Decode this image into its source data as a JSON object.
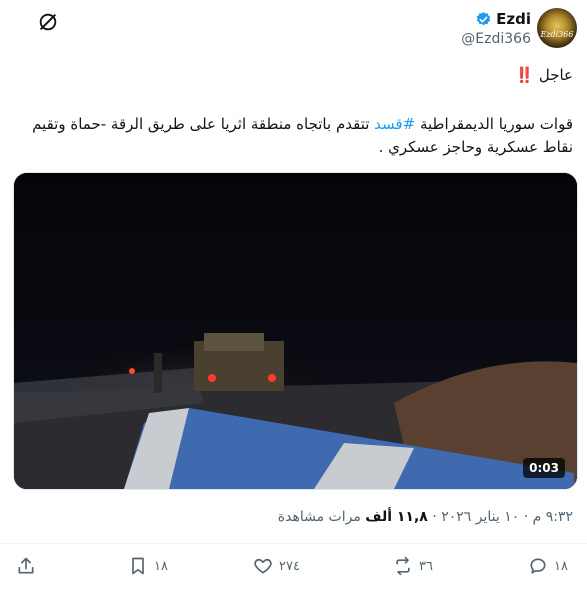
{
  "author": {
    "display_name": "Ezdi",
    "handle": "@Ezdi366",
    "avatar_text": "Ezdi366"
  },
  "post": {
    "urgent_label": "عاجل",
    "urgent_marks": "‼️",
    "text_before_hashtag": "قوات سوريا الديمقراطية ",
    "hashtag": "#قسد",
    "text_after_hashtag": " تتقدم باتجاه منطقة اثريا على طريق الرقة -حماة وتقيم نقاط عسكرية وحاجز عسكري ."
  },
  "video": {
    "duration": "0:03"
  },
  "meta": {
    "time_date": "٩:٣٢ م · ١٠ يناير ٢٠٢٦ · ",
    "views_count": "١١,٨ ألف",
    "views_label": " مرات مشاهدة"
  },
  "actions": {
    "replies": "١٨",
    "reposts": "٣٦",
    "likes": "٢٧٤",
    "bookmarks": "١٨"
  },
  "icons": {
    "grok": "grok-icon",
    "verified": "verified-badge-icon",
    "share": "share-icon",
    "bookmark": "bookmark-icon",
    "like": "heart-icon",
    "repost": "repost-icon",
    "reply": "reply-icon"
  },
  "colors": {
    "accent": "#1d9bf0",
    "muted": "#536471",
    "urgent": "#e0102b"
  }
}
